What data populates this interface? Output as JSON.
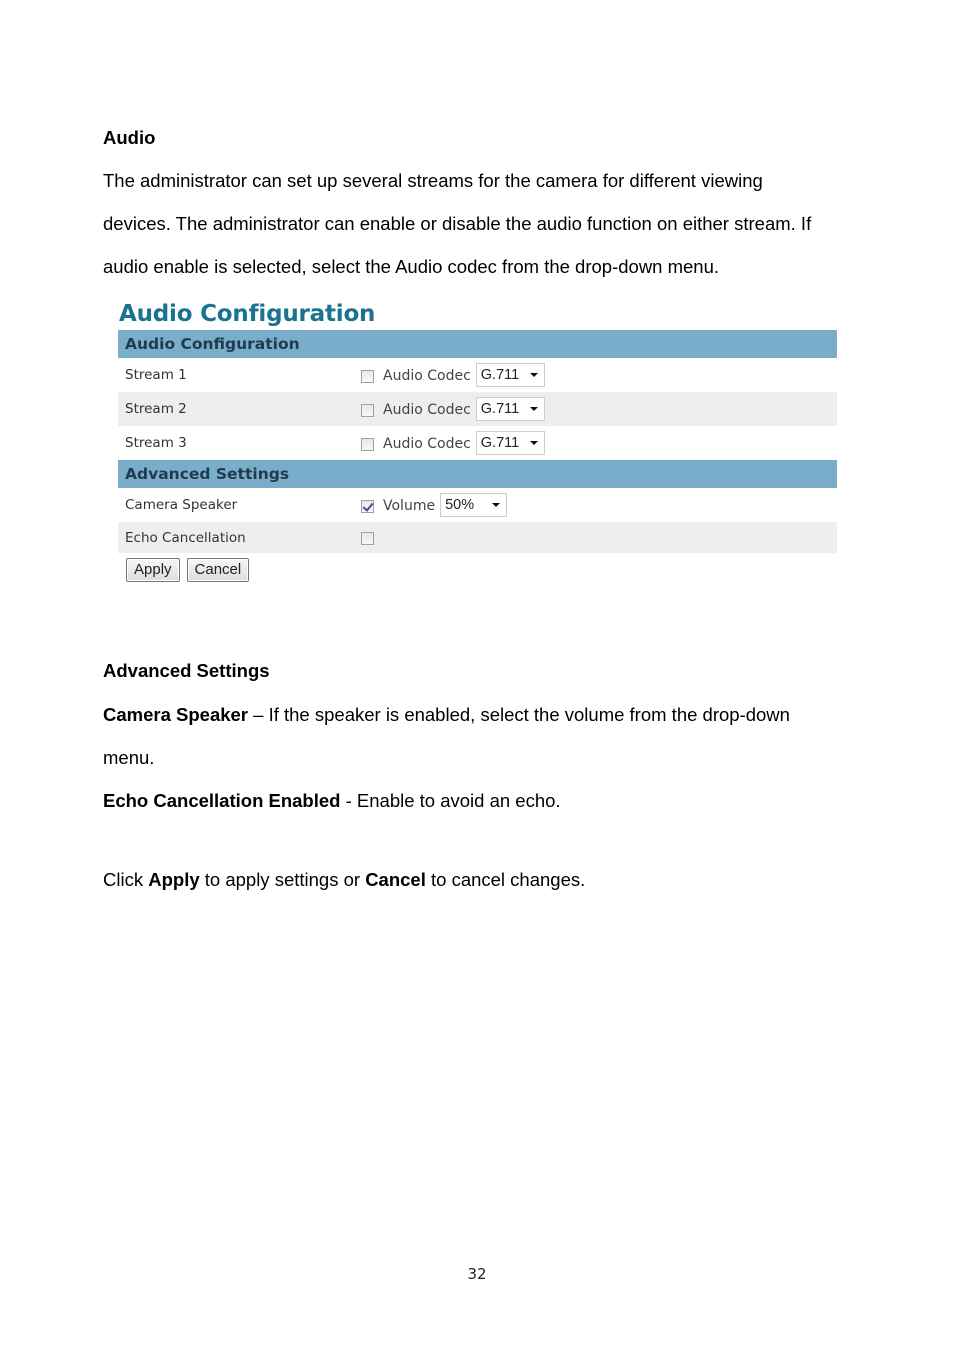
{
  "document": {
    "audio_heading": "Audio",
    "intro_lines": [
      "The administrator can set up several streams for the camera for different viewing",
      "devices. The administrator can enable or disable the audio function on either stream. If",
      "audio enable is selected, select the Audio codec from the drop-down menu."
    ],
    "advanced_heading": "Advanced Settings",
    "camera_speaker": {
      "term": "Camera Speaker",
      "desc_line1": " – If the speaker is enabled, select the volume from the drop-down",
      "desc_line2": "menu."
    },
    "echo_cancellation": {
      "term": "Echo Cancellation Enabled",
      "desc": " - Enable to avoid an echo."
    },
    "apply_sentence": {
      "part1": "Click ",
      "apply": "Apply",
      "part2": " to apply settings or ",
      "cancel": "Cancel",
      "part3": " to cancel changes."
    },
    "page_number": "32"
  },
  "ui": {
    "title": "Audio Configuration",
    "colors": {
      "title": "#1a7390",
      "section_header_bg": "#7aadc9",
      "alt_row_bg": "#eeeeee"
    },
    "audio_section": {
      "header": "Audio Configuration",
      "streams": [
        {
          "label": "Stream 1",
          "enabled": false,
          "control_label": "Audio Codec",
          "codec": "G.711"
        },
        {
          "label": "Stream 2",
          "enabled": false,
          "control_label": "Audio Codec",
          "codec": "G.711"
        },
        {
          "label": "Stream 3",
          "enabled": false,
          "control_label": "Audio Codec",
          "codec": "G.711"
        }
      ]
    },
    "advanced_section": {
      "header": "Advanced Settings",
      "camera_speaker": {
        "label": "Camera Speaker",
        "enabled": true,
        "control_label": "Volume",
        "volume": "50%"
      },
      "echo_cancellation": {
        "label": "Echo Cancellation",
        "enabled": false
      }
    },
    "buttons": {
      "apply": "Apply",
      "cancel": "Cancel"
    }
  }
}
